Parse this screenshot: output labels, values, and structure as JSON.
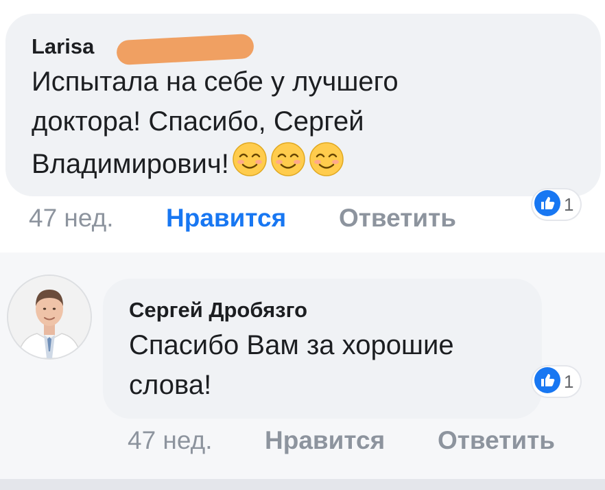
{
  "colors": {
    "link_blue": "#1877f2",
    "muted_gray": "#8d949e",
    "bubble_bg": "#f0f2f5",
    "redaction": "#f0a062"
  },
  "comments": [
    {
      "author": "Larisa",
      "author_redacted": true,
      "lines": [
        "Испытала на себе у лучшего",
        "доктора! Спасибо, Сергей",
        "Владимирович!"
      ],
      "emojis": [
        "smiling-face-icon",
        "smiling-face-icon",
        "smiling-face-icon"
      ],
      "time": "47 нед.",
      "like_label": "Нравится",
      "like_active": true,
      "reply_label": "Ответить",
      "reaction_icon": "thumbs-up-icon",
      "reaction_count": "1"
    },
    {
      "author": "Сергей Дробязго",
      "lines": [
        "Спасибо Вам за хорошие",
        "слова!"
      ],
      "time": "47 нед.",
      "like_label": "Нравится",
      "like_active": false,
      "reply_label": "Ответить",
      "reaction_icon": "thumbs-up-icon",
      "reaction_count": "1",
      "avatar_icon": "doctor-avatar-icon"
    }
  ]
}
